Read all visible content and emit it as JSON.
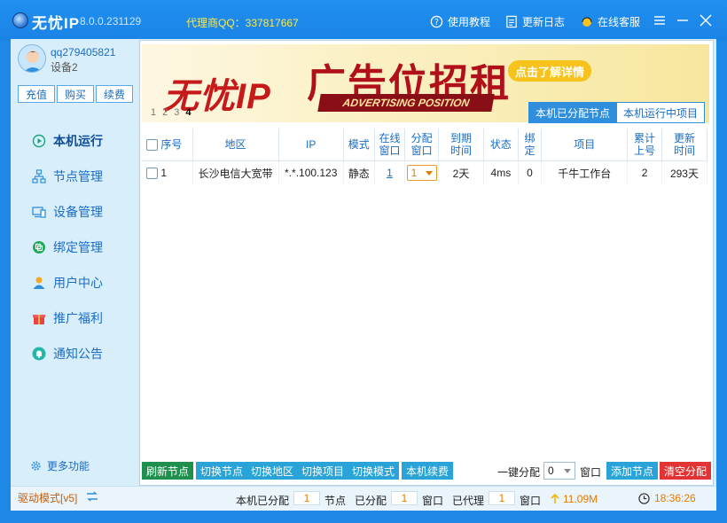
{
  "titlebar": {
    "app_name": "无忧IP",
    "version": "8.0.0.231129",
    "agent_qq": "代理商QQ：337817667",
    "tutorial_label": "使用教程",
    "changelog_label": "更新日志",
    "support_label": "在线客服"
  },
  "user": {
    "name": "qq279405821",
    "device": "设备2"
  },
  "account_buttons": {
    "recharge": "充值",
    "buy": "购买",
    "renew": "续费"
  },
  "sidebar": {
    "items": [
      {
        "label": "本机运行",
        "icon": "play-circle-icon",
        "active": true
      },
      {
        "label": "节点管理",
        "icon": "network-icon"
      },
      {
        "label": "设备管理",
        "icon": "device-icon"
      },
      {
        "label": "绑定管理",
        "icon": "bind-icon"
      },
      {
        "label": "用户中心",
        "icon": "user-icon"
      },
      {
        "label": "推广福利",
        "icon": "gift-icon"
      },
      {
        "label": "通知公告",
        "icon": "bell-icon"
      }
    ],
    "more": "更多功能"
  },
  "banner": {
    "logo": "无忧IP",
    "title": "广告位招租",
    "subtitle": "ADVERTISING POSITION",
    "cta": "点击了解详情",
    "pages": [
      "1",
      "2",
      "3",
      "4"
    ],
    "current_page": "4"
  },
  "tabs": {
    "assigned": "本机已分配节点",
    "running": "本机运行中项目"
  },
  "table": {
    "headers": {
      "index": "序号",
      "region": "地区",
      "ip": "IP",
      "mode": "模式",
      "online_win_1": "在线",
      "online_win_2": "窗口",
      "assign_win_1": "分配",
      "assign_win_2": "窗口",
      "expire_1": "到期",
      "expire_2": "时间",
      "status": "状态",
      "bind_1": "绑",
      "bind_2": "定",
      "project": "项目",
      "total_1": "累计",
      "total_2": "上号",
      "update_1": "更新",
      "update_2": "时间"
    },
    "rows": [
      {
        "index": "1",
        "region": "长沙电信大宽带",
        "ip": "*.*.100.123",
        "mode": "静态",
        "online_win": "1",
        "assign_win": "1",
        "expire": "2天",
        "status": "4ms",
        "bind": "0",
        "project": "千牛工作台",
        "total": "2",
        "update": "293天"
      }
    ]
  },
  "actions": {
    "refresh": "刷新节点",
    "switch_node": "切换节点",
    "switch_region": "切换地区",
    "switch_project": "切换项目",
    "switch_mode": "切换模式",
    "renew_local": "本机续费",
    "onekey_label": "一键分配",
    "onekey_value": "0",
    "onekey_unit": "窗口",
    "add_node": "添加节点",
    "clear_assign": "清空分配"
  },
  "footer": {
    "drive_mode": "驱动模式[v5]",
    "local_assigned_label": "本机已分配",
    "local_assigned_value": "1",
    "nodes_unit": "节点",
    "assigned_label": "已分配",
    "assigned_value": "1",
    "win_unit_1": "窗口",
    "proxied_label": "已代理",
    "proxied_value": "1",
    "win_unit_2": "窗口",
    "speed": "11.09M",
    "time": "18:36:26"
  },
  "colors": {
    "titlebar": "#1a84e6",
    "accent_blue": "#2f8fdc",
    "orange": "#e57a00",
    "green": "#1f8f4e",
    "red": "#e23434"
  }
}
